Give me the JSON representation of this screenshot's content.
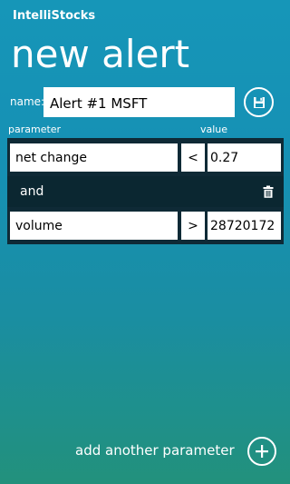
{
  "app": {
    "title": "IntelliStocks",
    "page_title": "new alert"
  },
  "name_field": {
    "label": "name:",
    "value": "Alert #1 MSFT"
  },
  "save_button": {
    "icon": "save-icon"
  },
  "columns": {
    "parameter": "parameter",
    "value": "value"
  },
  "conditions": [
    {
      "parameter": "net change",
      "operator": "<",
      "value": "0.27"
    },
    {
      "parameter": "volume",
      "operator": ">",
      "value": "28720172"
    }
  ],
  "connector": {
    "label": "and",
    "delete_icon": "trash-icon"
  },
  "footer": {
    "add_label": "add another parameter",
    "add_icon": "plus-icon"
  }
}
